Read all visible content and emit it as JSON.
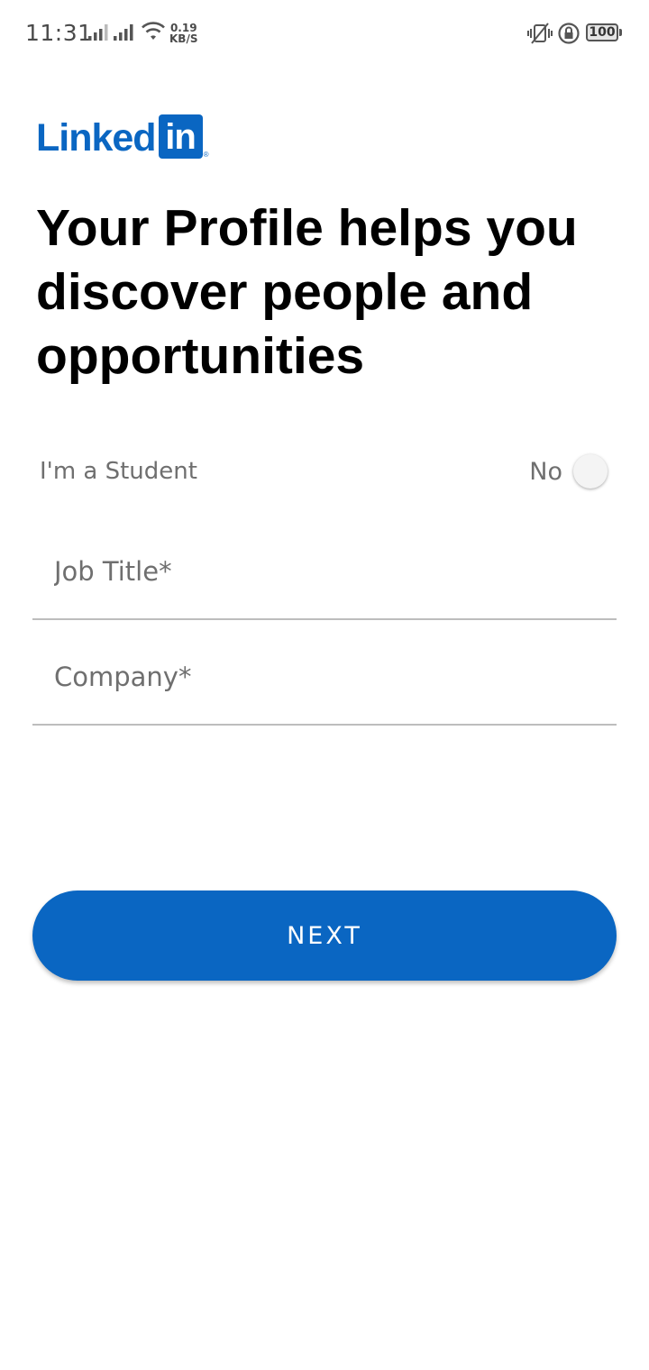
{
  "status_bar": {
    "time": "11:31",
    "net_speed_value": "0.19",
    "net_speed_unit": "KB/S",
    "battery": "100",
    "icons": [
      "signal-icon",
      "signal-icon",
      "wifi-icon",
      "vibrate-icon",
      "rotation-lock-icon",
      "battery-icon"
    ]
  },
  "logo": {
    "text": "Linked",
    "box_text": "in",
    "reg_mark": "®",
    "color": "#0a66c2"
  },
  "headline": "Your Profile helps you discover people and opportunities",
  "student": {
    "label": "I'm a Student",
    "toggle_state": "No"
  },
  "form": {
    "job_title_placeholder": "Job Title*",
    "job_title_value": "",
    "company_placeholder": "Company*",
    "company_value": ""
  },
  "next_button": {
    "label": "NEXT",
    "color": "#0a66c2"
  }
}
